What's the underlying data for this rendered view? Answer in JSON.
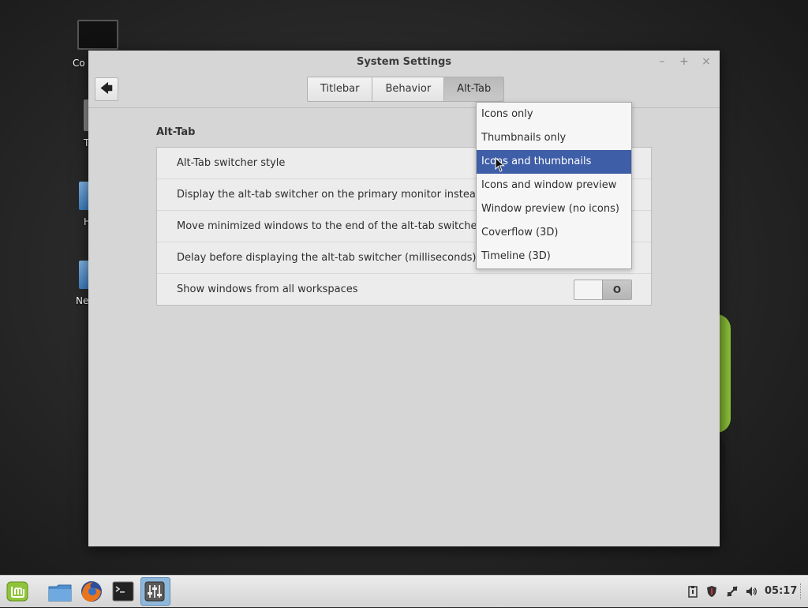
{
  "desktop": {
    "icon_labels": [
      "Co",
      "T",
      "H",
      "Ne"
    ]
  },
  "window": {
    "title": "System Settings",
    "minimize_glyph": "–",
    "maximize_glyph": "+",
    "close_glyph": "×",
    "back_glyph": "🡄"
  },
  "tabs": [
    {
      "label": "Titlebar",
      "active": false
    },
    {
      "label": "Behavior",
      "active": false
    },
    {
      "label": "Alt-Tab",
      "active": true
    }
  ],
  "section": {
    "title": "Alt-Tab",
    "rows": [
      {
        "label": "Alt-Tab switcher style"
      },
      {
        "label": "Display the alt-tab switcher on the primary monitor instead of th"
      },
      {
        "label": "Move minimized windows to the end of the alt-tab switcher"
      },
      {
        "label": "Delay before displaying the alt-tab switcher (milliseconds)"
      },
      {
        "label": "Show windows from all workspaces",
        "toggle_state": "off",
        "toggle_glyph": "O"
      }
    ]
  },
  "dropdown": {
    "options": [
      "Icons only",
      "Thumbnails only",
      "Icons and thumbnails",
      "Icons and window preview",
      "Window preview (no icons)",
      "Coverflow (3D)",
      "Timeline (3D)"
    ],
    "selected": "Icons and thumbnails"
  },
  "taskbar": {
    "launchers": [
      "mint-menu-icon",
      "files-icon",
      "firefox-icon",
      "terminal-icon",
      "system-settings-icon"
    ],
    "tray": [
      "clipboard-icon",
      "update-shield-icon",
      "network-icon",
      "volume-icon"
    ],
    "clock": "05:17"
  },
  "colors": {
    "selection": "#3f5ea8",
    "window_bg": "#d6d6d6",
    "mint_green": "#8fc43a"
  }
}
